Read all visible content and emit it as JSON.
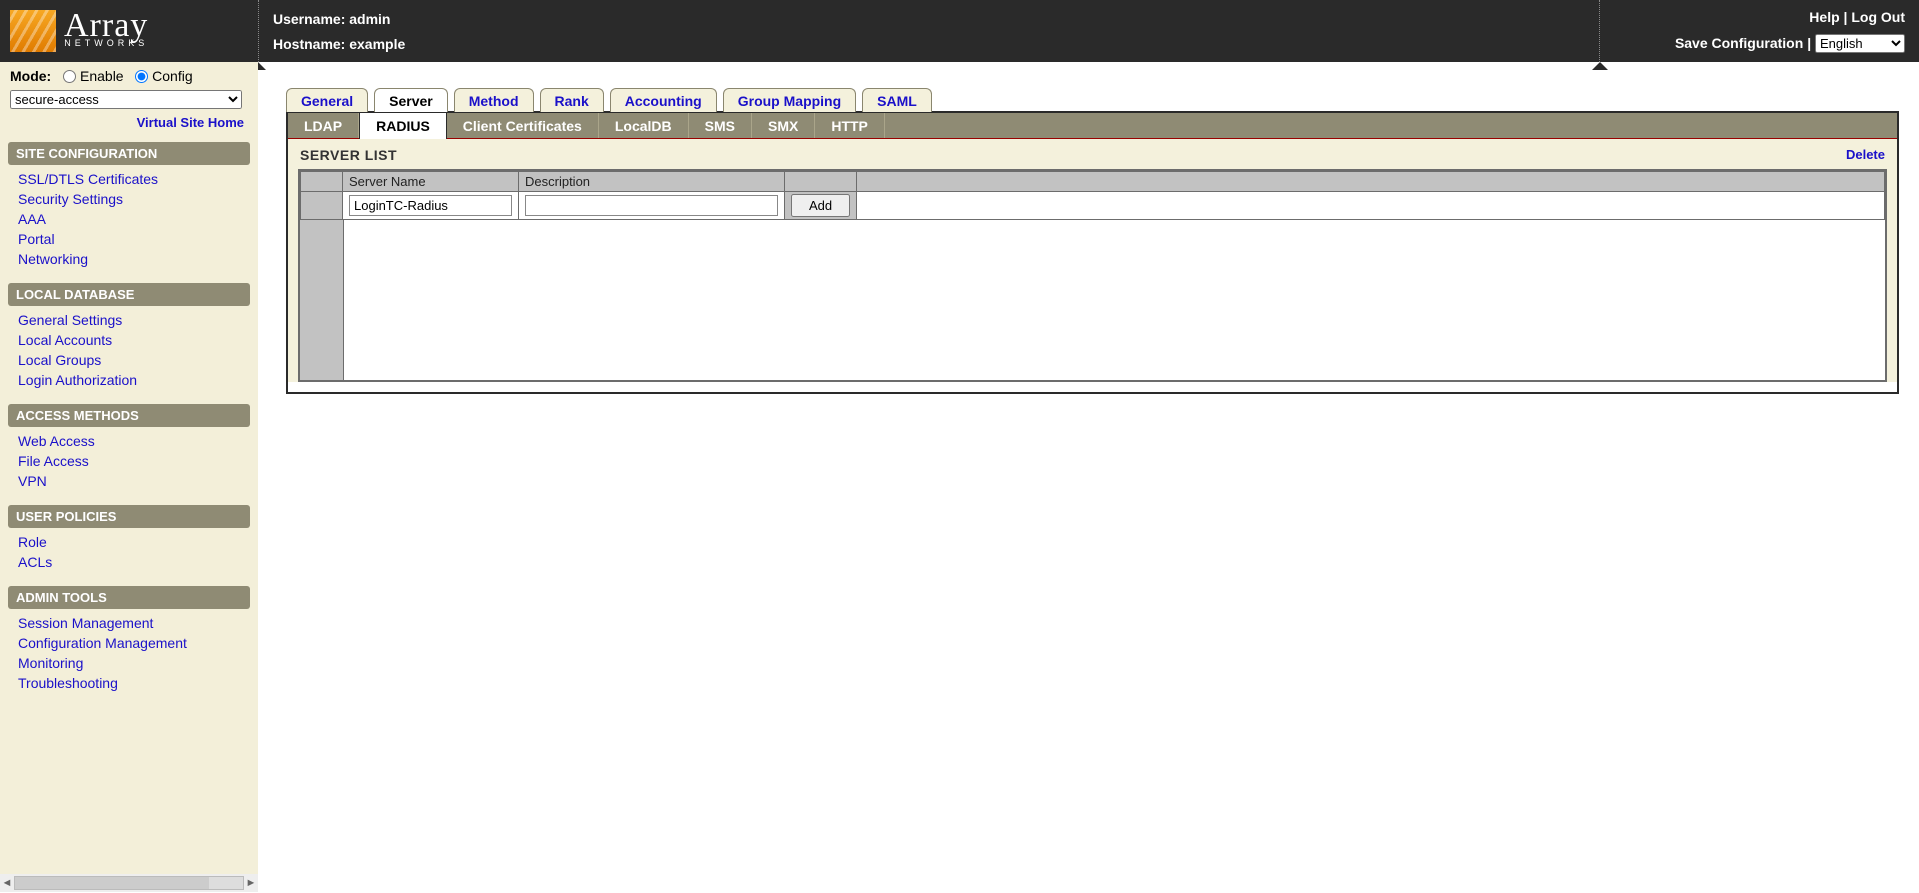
{
  "brand": {
    "name": "Array",
    "sub": "NETWORKS"
  },
  "header": {
    "username_label": "Username: admin",
    "hostname_label": "Hostname: example",
    "help": "Help",
    "logout": "Log Out",
    "save_config": "Save Configuration",
    "language": "English"
  },
  "mode": {
    "label": "Mode:",
    "enable": "Enable",
    "config": "Config",
    "selected": "config",
    "site_select": "secure-access",
    "vs_home": "Virtual Site Home"
  },
  "sidebar": {
    "groups": [
      {
        "title": "SITE CONFIGURATION",
        "items": [
          "SSL/DTLS Certificates",
          "Security Settings",
          "AAA",
          "Portal",
          "Networking"
        ]
      },
      {
        "title": "LOCAL DATABASE",
        "items": [
          "General Settings",
          "Local Accounts",
          "Local Groups",
          "Login Authorization"
        ]
      },
      {
        "title": "ACCESS METHODS",
        "items": [
          "Web Access",
          "File Access",
          "VPN"
        ]
      },
      {
        "title": "USER POLICIES",
        "items": [
          "Role",
          "ACLs"
        ]
      },
      {
        "title": "ADMIN TOOLS",
        "items": [
          "Session Management",
          "Configuration Management",
          "Monitoring",
          "Troubleshooting"
        ]
      }
    ]
  },
  "tabs_primary": [
    "General",
    "Server",
    "Method",
    "Rank",
    "Accounting",
    "Group Mapping",
    "SAML"
  ],
  "tabs_primary_active": "Server",
  "tabs_secondary": [
    "LDAP",
    "RADIUS",
    "Client Certificates",
    "LocalDB",
    "SMS",
    "SMX",
    "HTTP"
  ],
  "tabs_secondary_active": "RADIUS",
  "panel": {
    "title": "SERVER LIST",
    "delete": "Delete",
    "columns": {
      "c0": "",
      "c1": "Server Name",
      "c2": "Description",
      "c3": ""
    },
    "row": {
      "server_name": "LoginTC-Radius",
      "description": ""
    },
    "add_btn": "Add"
  }
}
